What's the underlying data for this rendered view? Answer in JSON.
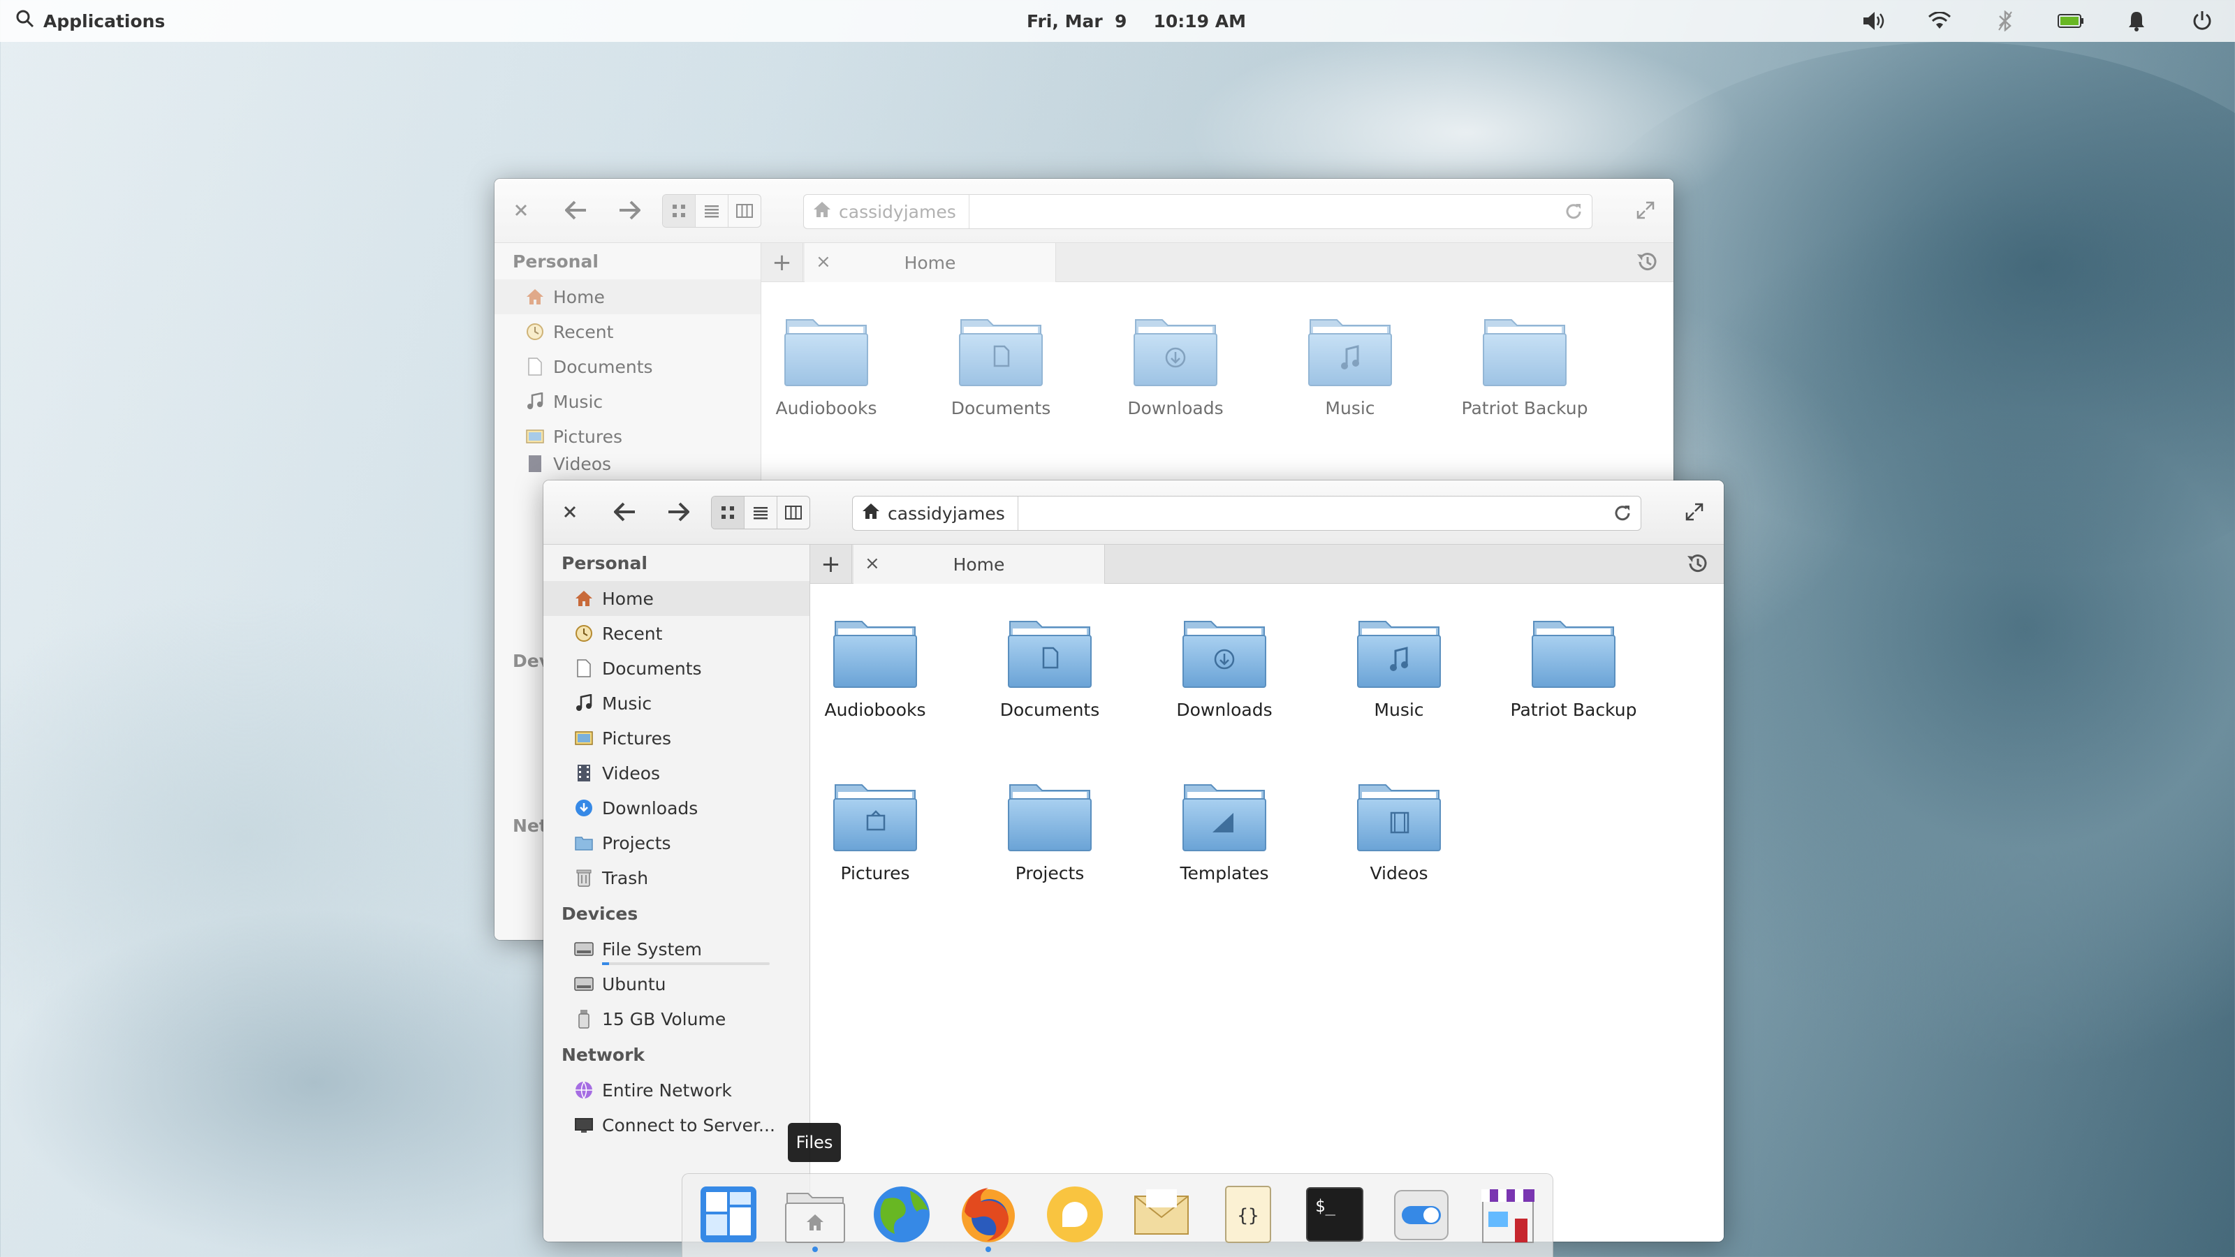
{
  "panel": {
    "applications_label": "Applications",
    "date": "Fri, Mar  9",
    "time": "10:19 AM",
    "indicators": [
      "volume-icon",
      "wifi-icon",
      "bluetooth-icon",
      "battery-icon",
      "notifications-icon",
      "power-icon"
    ]
  },
  "back_window": {
    "breadcrumb": "cassidyjames",
    "tab_new": "+",
    "tab_close": "×",
    "tab_label": "Home",
    "sidebar": {
      "personal_header": "Personal",
      "items": [
        "Home",
        "Recent",
        "Documents",
        "Music",
        "Pictures",
        "Videos"
      ],
      "devices_header_partial": "Dev",
      "network_header_partial": "Net"
    },
    "folders": [
      "Audiobooks",
      "Documents",
      "Downloads",
      "Music",
      "Patriot Backup"
    ]
  },
  "front_window": {
    "close": "×",
    "breadcrumb": "cassidyjames",
    "tab_new": "+",
    "tab_close": "×",
    "tab_label": "Home",
    "sidebar": {
      "personal_header": "Personal",
      "personal_items": [
        "Home",
        "Recent",
        "Documents",
        "Music",
        "Pictures",
        "Videos",
        "Downloads",
        "Projects",
        "Trash"
      ],
      "devices_header": "Devices",
      "device_items": [
        "File System",
        "Ubuntu",
        "15 GB Volume"
      ],
      "network_header": "Network",
      "network_items": [
        "Entire Network",
        "Connect to Server..."
      ]
    },
    "folders": [
      "Audiobooks",
      "Documents",
      "Downloads",
      "Music",
      "Patriot Backup",
      "Pictures",
      "Projects",
      "Templates",
      "Videos"
    ]
  },
  "dock": {
    "tooltip": "Files",
    "apps": [
      "multitasking-view-icon",
      "files-icon",
      "web-browser-icon",
      "firefox-icon",
      "messaging-icon",
      "mail-icon",
      "code-editor-icon",
      "terminal-icon",
      "system-settings-icon",
      "appcenter-icon"
    ]
  },
  "colors": {
    "accent": "#3689e6",
    "folder": "#8cbbe2",
    "folder_dark": "#5a8fbf"
  }
}
